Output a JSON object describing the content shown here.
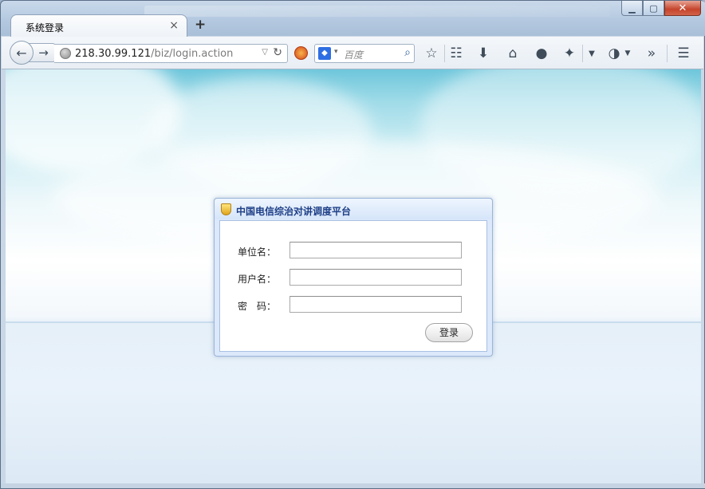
{
  "browser": {
    "tab_title": "系统登录",
    "tab_close": "×",
    "new_tab": "+",
    "url_host": "218.30.99.121",
    "url_path": "/biz/login.action",
    "search_placeholder": "百度",
    "window_buttons": {
      "minimize": "▁",
      "maximize": "▢",
      "close": "✕"
    },
    "toolbar_icons": [
      "bookmark-star-icon",
      "reading-list-icon",
      "download-icon",
      "home-icon",
      "chat-icon",
      "extension-icon",
      "sync-icon",
      "overflow-icon",
      "menu-icon"
    ]
  },
  "login": {
    "title": "中国电信综治对讲调度平台",
    "fields": {
      "unit_label": "单位名：",
      "user_label": "用户名：",
      "password_label": "密　码："
    },
    "submit_label": "登录"
  },
  "colors": {
    "title_text": "#1d3e86",
    "panel_border": "#9bb4d8",
    "sky_top": "#6ec6db"
  }
}
